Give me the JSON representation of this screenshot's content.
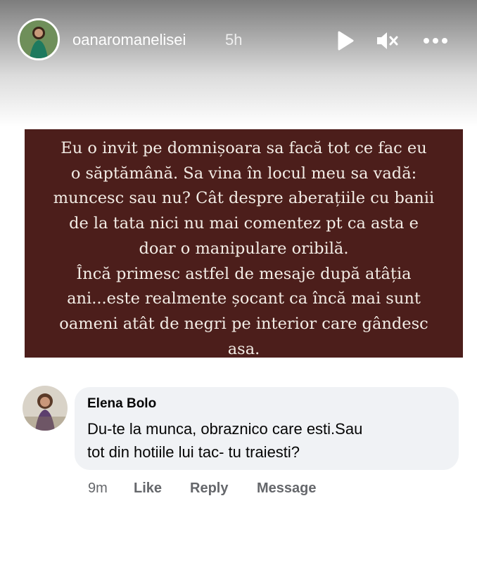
{
  "story": {
    "username": "oanaromanelisei",
    "time": "5h",
    "controls": {
      "play_icon": "play-icon",
      "mute_icon": "volume-muted-icon",
      "more_icon": "more-horizontal-icon"
    }
  },
  "quote": {
    "text": "Eu o invit pe domnișoara sa facă tot ce fac eu\no săptămână. Sa vina în locul meu sa vadă:\nmuncesc sau nu? Cât despre aberațiile cu banii\nde la tata nici nu mai comentez pt ca asta e\ndoar o manipulare oribilă.\nÎncă primesc astfel de mesaje după atâția\nani...este realmente șocant ca încă mai sunt\noameni atât de negri pe interior care gândesc\nasa.",
    "background": "#4c1e1b",
    "text_color": "#f3ede6"
  },
  "comment": {
    "author": "Elena Bolo",
    "text": "Du-te la munca, obraznico care esti.Sau\ntot din hotiile lui tac- tu traiesti?",
    "time": "9m",
    "like_label": "Like",
    "reply_label": "Reply",
    "message_label": "Message",
    "bubble_color": "#f0f2f5"
  }
}
